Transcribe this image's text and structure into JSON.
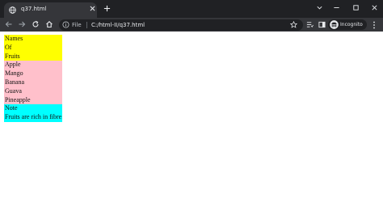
{
  "browser": {
    "tab_title": "q37.html",
    "url_scheme_label": "File",
    "url": "C:/html-II/q37.html",
    "profile_label": "Incognito"
  },
  "page": {
    "paragraphs": [
      {
        "text": "Names",
        "bg": "#ffff00"
      },
      {
        "text": "Of",
        "bg": "#ffff00"
      },
      {
        "text": "Fruits",
        "bg": "#ffff00"
      },
      {
        "text": "Apple",
        "bg": "#ffc0cb"
      },
      {
        "text": "Mango",
        "bg": "#ffc0cb"
      },
      {
        "text": "Banana",
        "bg": "#ffc0cb"
      },
      {
        "text": "Guava",
        "bg": "#ffc0cb"
      },
      {
        "text": "Pineapple",
        "bg": "#ffc0cb"
      },
      {
        "text": "Note",
        "bg": "#00ffff"
      },
      {
        "text": "Fruits are rich in fibre.",
        "bg": "#00ffff"
      }
    ]
  },
  "colors": {
    "tabstrip": "#202124",
    "toolbar": "#35363a",
    "omnibox": "#202124"
  },
  "icons": [
    "globe-icon",
    "close-icon",
    "plus-icon",
    "chevron-down-icon",
    "minimize-icon",
    "maximize-icon",
    "back-icon",
    "forward-icon",
    "reload-icon",
    "home-icon",
    "info-icon",
    "star-icon",
    "reading-list-icon",
    "side-panel-icon",
    "incognito-icon",
    "menu-icon"
  ]
}
